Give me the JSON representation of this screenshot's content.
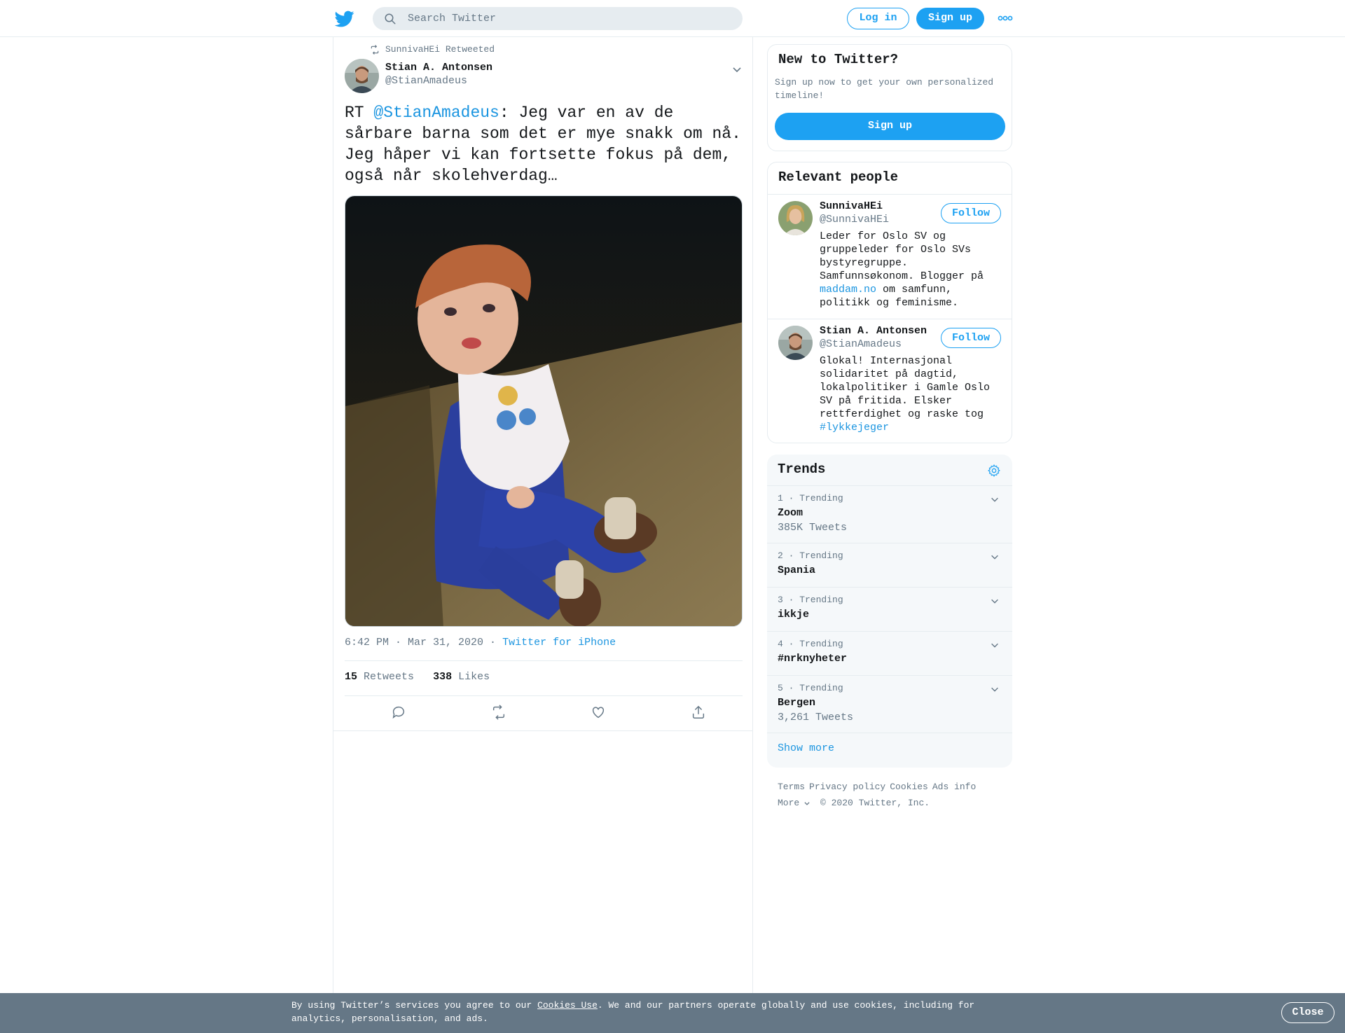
{
  "header": {
    "search_placeholder": "Search Twitter",
    "login_label": "Log in",
    "signup_label": "Sign up"
  },
  "tweet": {
    "retweeted_by": "SunnivaHEi Retweeted",
    "author_name": "Stian A. Antonsen",
    "author_handle": "@StianAmadeus",
    "text_prefix": "RT ",
    "text_mention": "@StianAmadeus",
    "text_body": ": Jeg var en av de sårbare barna som det er mye snakk om nå. Jeg håper vi kan fortsette fokus på dem, også når skolehverdag…",
    "time_date": "6:42 PM · Mar 31, 2020",
    "source_sep": " · ",
    "source": "Twitter for iPhone",
    "retweets_count": "15",
    "retweets_label": "Retweets",
    "likes_count": "338",
    "likes_label": "Likes"
  },
  "sidebar": {
    "new_title": "New to Twitter?",
    "new_desc": "Sign up now to get your own personalized timeline!",
    "new_signup": "Sign up",
    "people_title": "Relevant people",
    "people": [
      {
        "name": "SunnivaHEi",
        "handle": "@SunnivaHEi",
        "bio_pre": "Leder for Oslo SV og gruppeleder for Oslo SVs bystyregruppe. Samfunnsøkonom. Blogger på ",
        "bio_link": "maddam.no",
        "bio_post": " om samfunn, politikk og feminisme.",
        "follow": "Follow"
      },
      {
        "name": "Stian A. Antonsen",
        "handle": "@StianAmadeus",
        "bio_pre": "Glokal! Internasjonal solidaritet på dagtid, lokalpolitiker i Gamle Oslo SV på fritida. Elsker rettferdighet og raske tog ",
        "bio_link": "#lykkejeger",
        "bio_post": "",
        "follow": "Follow"
      }
    ],
    "trends_title": "Trends",
    "trends": [
      {
        "meta": "1 · Trending",
        "name": "Zoom",
        "count": "385K Tweets"
      },
      {
        "meta": "2 · Trending",
        "name": "Spania",
        "count": ""
      },
      {
        "meta": "3 · Trending",
        "name": "ikkje",
        "count": ""
      },
      {
        "meta": "4 · Trending",
        "name": "#nrknyheter",
        "count": ""
      },
      {
        "meta": "5 · Trending",
        "name": "Bergen",
        "count": "3,261 Tweets"
      }
    ],
    "show_more": "Show more"
  },
  "footer": {
    "links": [
      "Terms",
      "Privacy policy",
      "Cookies",
      "Ads info"
    ],
    "more": "More",
    "copyright": "© 2020 Twitter, Inc."
  },
  "cookie_bar": {
    "text_pre": "By using Twitter’s services you agree to our ",
    "link": "Cookies Use",
    "text_post": ". We and our partners operate globally and use cookies, including for analytics, personalisation, and ads.",
    "close": "Close"
  },
  "colors": {
    "brand": "#1da1f2",
    "link": "#1b95e0",
    "muted": "#657786",
    "cookie_bg": "#657786"
  },
  "icons": [
    "twitter-bird-icon",
    "search-icon",
    "more-dots-icon",
    "retweet-icon",
    "chevron-down-icon",
    "reply-icon",
    "like-icon",
    "share-icon",
    "gear-icon"
  ]
}
